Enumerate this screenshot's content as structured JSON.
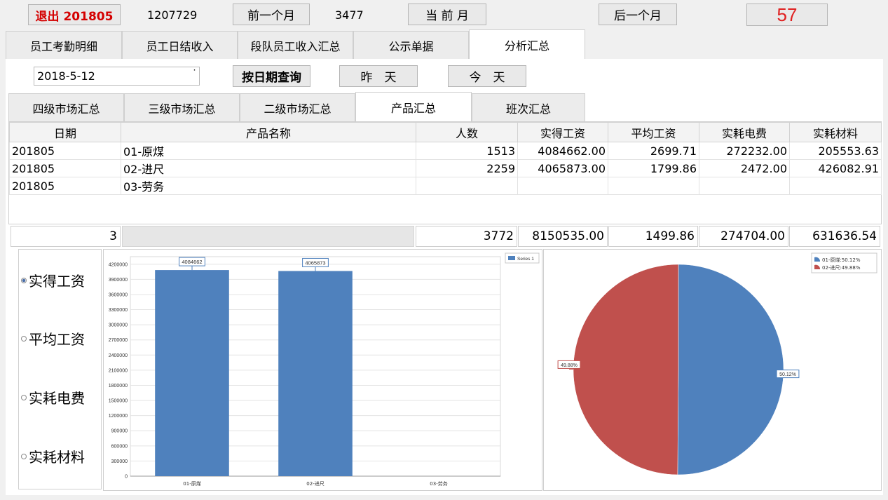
{
  "toolbar": {
    "exit_label": "退出 201805",
    "value_a": "1207729",
    "prev_month": "前一个月",
    "value_b": "3477",
    "current_month": "当 前 月",
    "next_month": "后一个月",
    "counter": "57"
  },
  "tabs": [
    "员工考勤明细",
    "员工日结收入",
    "段队员工收入汇总",
    "公示单据",
    "分析汇总"
  ],
  "active_tab": "分析汇总",
  "date_picker": {
    "value": "2018-5-12",
    "arrow": "˙"
  },
  "query_buttons": {
    "by_date": "按日期查询",
    "yesterday": "昨　天",
    "today": "今　天"
  },
  "subtabs": [
    "四级市场汇总",
    "三级市场汇总",
    "二级市场汇总",
    "产品汇总",
    "班次汇总"
  ],
  "active_subtab": "产品汇总",
  "table": {
    "headers": [
      "日期",
      "产品名称",
      "人数",
      "实得工资",
      "平均工资",
      "实耗电费",
      "实耗材料"
    ],
    "rows": [
      [
        "201805",
        "01-原煤",
        "1513",
        "4084662.00",
        "2699.71",
        "272232.00",
        "205553.63"
      ],
      [
        "201805",
        "02-进尺",
        "2259",
        "4065873.00",
        "1799.86",
        "2472.00",
        "426082.91"
      ],
      [
        "201805",
        "03-劳务",
        "",
        "",
        "",
        "",
        ""
      ]
    ],
    "totals": [
      "3",
      "",
      "3772",
      "8150535.00",
      "1499.86",
      "274704.00",
      "631636.54"
    ]
  },
  "radio_options": [
    "实得工资",
    "平均工资",
    "实耗电费",
    "实耗材料"
  ],
  "selected_radio": 0,
  "colors": {
    "blue": "#4f81bd",
    "red": "#c0504d",
    "counter_red": "#e02020",
    "exit_red": "#d40000"
  },
  "chart_data": [
    {
      "type": "bar",
      "categories": [
        "01-原煤",
        "02-进尺",
        "03-劳务"
      ],
      "series": [
        {
          "name": "Series 1",
          "values": [
            4084662,
            4065873,
            0
          ]
        }
      ],
      "data_labels": [
        "4084662",
        "4065873"
      ],
      "y_ticks": [
        "0",
        "300000",
        "600000",
        "900000",
        "1200000",
        "1500000",
        "1800000",
        "2100000",
        "2400000",
        "2700000",
        "3000000",
        "3300000",
        "3600000",
        "3900000",
        "4200000"
      ],
      "ylim": [
        0,
        4350000
      ],
      "grid": true,
      "legend": "top-right"
    },
    {
      "type": "pie",
      "slices": [
        {
          "label": "01-原煤",
          "value": 50.12,
          "color": "#4f81bd",
          "legend": "01-原煤:50.12%",
          "data_label": "50.12%"
        },
        {
          "label": "02-进尺",
          "value": 49.88,
          "color": "#c0504d",
          "legend": "02-进尺:49.88%",
          "data_label": "49.88%"
        }
      ],
      "legend": "top-right"
    }
  ]
}
